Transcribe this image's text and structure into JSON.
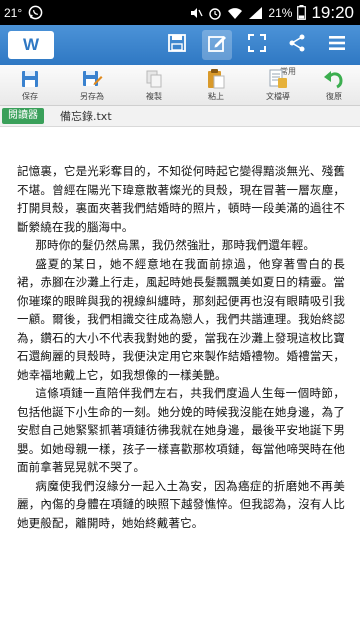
{
  "statusbar": {
    "temperature": "21°",
    "battery_percent": "21%",
    "time": "19:20",
    "icons": [
      "whatsapp-icon",
      "mute-icon",
      "alarm-icon",
      "wifi-icon",
      "signal-icon",
      "battery-icon"
    ]
  },
  "titlebar": {
    "logo_text": "W",
    "actions": [
      "save-icon",
      "edit-icon",
      "fullscreen-icon",
      "share-icon",
      "menu-icon"
    ]
  },
  "ribbon": {
    "group_label": "常用",
    "buttons": [
      {
        "label": "保存",
        "icon": "save-icon"
      },
      {
        "label": "另存為",
        "icon": "save-as-icon"
      },
      {
        "label": "複製",
        "icon": "copy-icon"
      },
      {
        "label": "粘上",
        "icon": "paste-icon"
      },
      {
        "label": "文檔導",
        "icon": "document-icon"
      },
      {
        "label": "復原",
        "icon": "undo-icon"
      }
    ]
  },
  "tabstrip": {
    "badge": "閱讀器",
    "filename": "備忘錄.txt"
  },
  "document": {
    "paragraphs": [
      {
        "indent": false,
        "text": "記憶裏，它是光彩奪目的，不知從何時起它變得黯淡無光、殘舊不堪。曾經在陽光下瑋意散著燦光的貝殼，現在冒著一層灰塵，打開貝殼，裏面夾著我們結婚時的照片，頓時一段美滿的過往不斷縈繞在我的腦海中。"
      },
      {
        "indent": true,
        "text": "那時你的髮仍然烏黑，我仍然強壯，那時我們還年輕。"
      },
      {
        "indent": true,
        "text": "盛夏的某日，她不經意地在我面前掠過，他穿著雪白的長裙，赤腳在沙灘上行走，風起時她長髮飄飄美如夏日的精靈。當你璀璨的眼眸與我的視線糾纏時，那刻起便再也沒有眼睛吸引我一顧。爾後，我們相識交往成為戀人，我們共諧連理。我始終認為，鑽石的大小不代表我對她的愛，當我在沙灘上發現這枚比寶石還絢麗的貝殼時，我便決定用它來製作結婚禮物。婚禮當天，她幸福地戴上它，如我想像的一樣美艷。"
      },
      {
        "indent": true,
        "text": "這條項鏈一直陪伴我們左右，共我們度過人生每一個時節，包括他誕下小生命的一刻。她分娩的時候我沒能在她身邊，為了安慰自己她緊緊抓著項鏈彷彿我就在她身邊，最後平安地誕下男嬰。如她母親一樣，孩子一樣喜歡那枚項鏈，每當他啼哭時在他面前拿著晃晃就不哭了。"
      },
      {
        "indent": true,
        "text": "病魔使我們沒緣分一起入土為安，因為癌症的折磨她不再美麗，內傷的身體在項鏈的映照下越發憔悴。但我認為，沒有人比她更般配，離開時，她始終戴著它。"
      }
    ]
  }
}
